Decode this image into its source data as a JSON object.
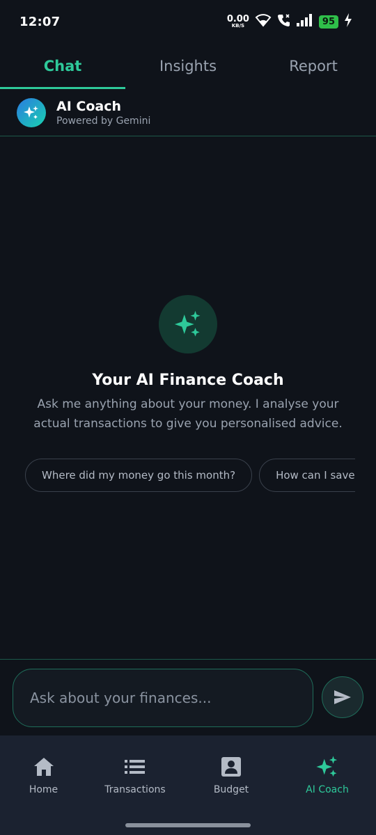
{
  "status": {
    "time": "12:07",
    "net_speed_value": "0.00",
    "net_speed_unit": "KB/S",
    "battery": "95"
  },
  "tabs": [
    {
      "label": "Chat",
      "active": true
    },
    {
      "label": "Insights",
      "active": false
    },
    {
      "label": "Report",
      "active": false
    }
  ],
  "coach": {
    "title": "AI Coach",
    "subtitle": "Powered by Gemini"
  },
  "empty_state": {
    "title": "Your AI Finance Coach",
    "description": "Ask me anything about your money. I analyse your actual transactions to give you personalised advice."
  },
  "suggestions": [
    "Where did my money go this month?",
    "How can I save more?"
  ],
  "composer": {
    "placeholder": "Ask about your finances..."
  },
  "nav": [
    {
      "label": "Home",
      "icon": "home-icon"
    },
    {
      "label": "Transactions",
      "icon": "list-icon"
    },
    {
      "label": "Budget",
      "icon": "budget-icon"
    },
    {
      "label": "AI Coach",
      "icon": "sparkles-icon",
      "active": true
    }
  ],
  "colors": {
    "accent": "#2ec99a",
    "background": "#0f131a",
    "nav_background": "#1b2230"
  }
}
